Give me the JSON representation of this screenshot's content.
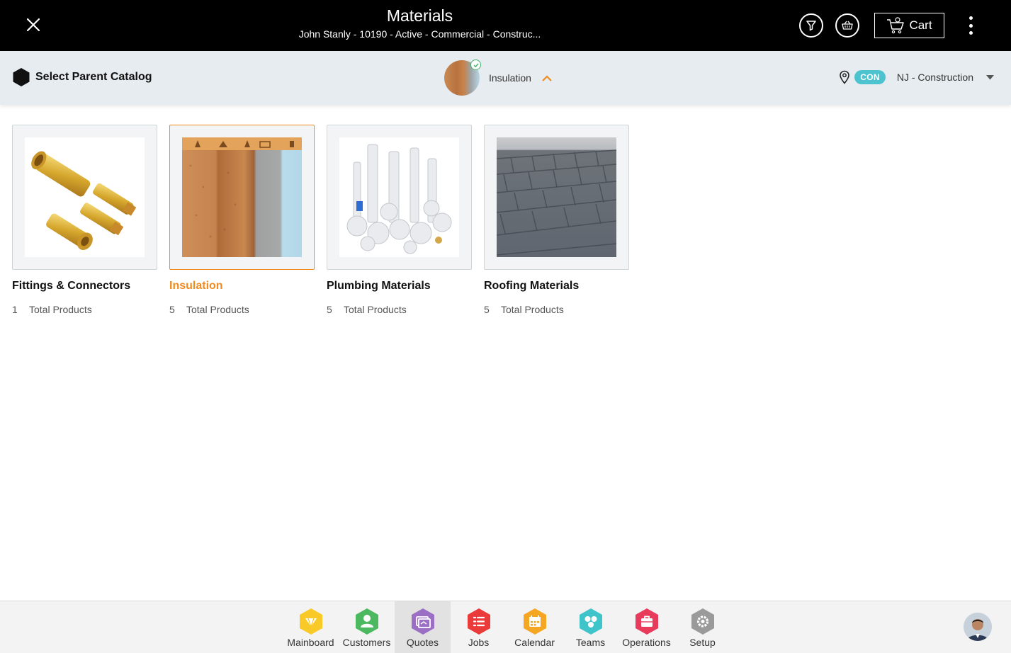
{
  "header": {
    "title": "Materials",
    "subtitle": "John Stanly - 10190 - Active - Commercial - Construc...",
    "cart_label": "Cart"
  },
  "catalog_bar": {
    "parent_label": "Select Parent Catalog",
    "selected_catalog": "Insulation",
    "location_badge": "CON",
    "location_label": "NJ - Construction"
  },
  "categories": [
    {
      "name": "Fittings & Connectors",
      "count": "1",
      "count_label": "Total Products",
      "selected": false
    },
    {
      "name": "Insulation",
      "count": "5",
      "count_label": "Total Products",
      "selected": true
    },
    {
      "name": "Plumbing Materials",
      "count": "5",
      "count_label": "Total Products",
      "selected": false
    },
    {
      "name": "Roofing Materials",
      "count": "5",
      "count_label": "Total Products",
      "selected": false
    }
  ],
  "bottom_nav": {
    "items": [
      {
        "label": "Mainboard",
        "icon": "mainboard-icon",
        "color": "#f9c928"
      },
      {
        "label": "Customers",
        "icon": "customers-icon",
        "color": "#4cb860"
      },
      {
        "label": "Quotes",
        "icon": "quotes-icon",
        "color": "#9b6fc4"
      },
      {
        "label": "Jobs",
        "icon": "jobs-icon",
        "color": "#ea3a3a"
      },
      {
        "label": "Calendar",
        "icon": "calendar-icon",
        "color": "#f5a623"
      },
      {
        "label": "Teams",
        "icon": "teams-icon",
        "color": "#3fc4c9"
      },
      {
        "label": "Operations",
        "icon": "operations-icon",
        "color": "#e83a5b"
      },
      {
        "label": "Setup",
        "icon": "setup-icon",
        "color": "#9a9a9a"
      }
    ],
    "active": "Quotes"
  },
  "colors": {
    "accent": "#f08c1f",
    "header_bg": "#000000",
    "catalog_bar_bg": "#e6ecef",
    "badge": "#4cc3cf"
  }
}
